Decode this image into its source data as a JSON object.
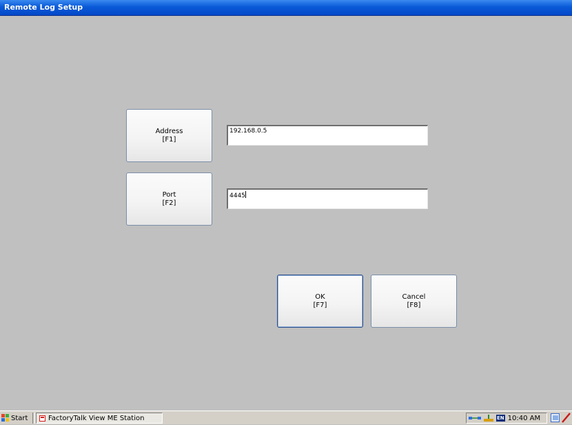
{
  "window": {
    "title": "Remote Log Setup"
  },
  "form": {
    "address_button": {
      "line1": "Address",
      "line2": "[F1]"
    },
    "address_value": "192.168.0.5",
    "port_button": {
      "line1": "Port",
      "line2": "[F2]"
    },
    "port_value": "4445",
    "ok_button": {
      "line1": "OK",
      "line2": "[F7]"
    },
    "cancel_button": {
      "line1": "Cancel",
      "line2": "[F8]"
    }
  },
  "taskbar": {
    "start_label": "Start",
    "start_icon": "windows-flag-icon",
    "task_label": "FactoryTalk View ME Station",
    "task_icon": "factorytalk-icon",
    "tray": {
      "network_icon": "network-icon",
      "keyboard_icon": "keyboard-icon",
      "language": "EN",
      "time": "10:40 AM",
      "desktop_icon": "show-desktop-icon",
      "pen_icon": "input-panel-icon"
    }
  },
  "colors": {
    "titlebar": "#0a5ad8",
    "background": "#c0c0c0"
  }
}
